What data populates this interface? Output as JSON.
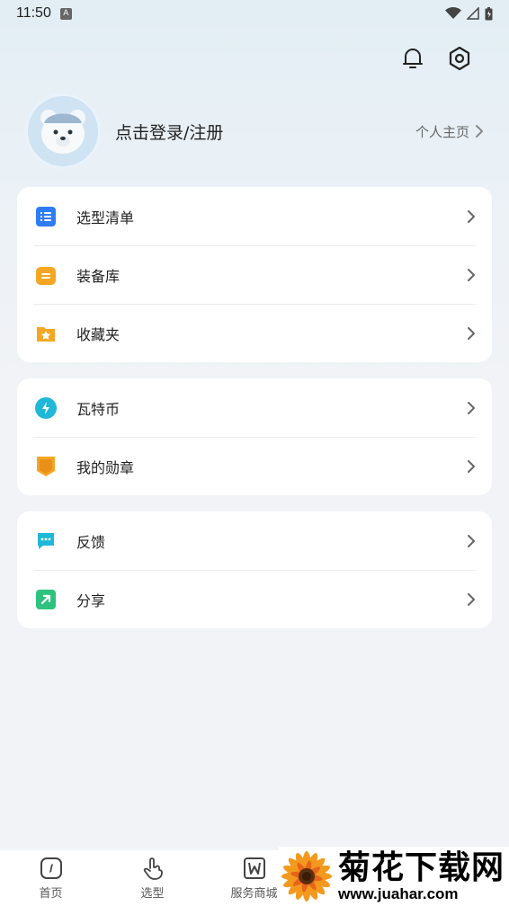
{
  "status_bar": {
    "time": "11:50",
    "notif_letter": "A"
  },
  "profile": {
    "login_text": "点击登录/注册",
    "homepage_label": "个人主页"
  },
  "menu_groups": [
    {
      "items": [
        {
          "label": "选型清单",
          "icon": "list-icon"
        },
        {
          "label": "装备库",
          "icon": "box-icon"
        },
        {
          "label": "收藏夹",
          "icon": "folder-star-icon"
        }
      ]
    },
    {
      "items": [
        {
          "label": "瓦特币",
          "icon": "coin-icon"
        },
        {
          "label": "我的勋章",
          "icon": "medal-icon"
        }
      ]
    },
    {
      "items": [
        {
          "label": "反馈",
          "icon": "chat-icon"
        },
        {
          "label": "分享",
          "icon": "share-icon"
        }
      ]
    }
  ],
  "tabbar": [
    {
      "label": "首页",
      "icon": "compass-icon"
    },
    {
      "label": "选型",
      "icon": "hand-icon"
    },
    {
      "label": "服务商城",
      "icon": "shop-icon"
    }
  ],
  "watermark": {
    "title": "菊花下载网",
    "url": "www.juahar.com"
  },
  "colors": {
    "accent_blue": "#2f7df6",
    "orange": "#f5a623",
    "teal": "#1fb8d8",
    "green": "#2ec27e"
  }
}
